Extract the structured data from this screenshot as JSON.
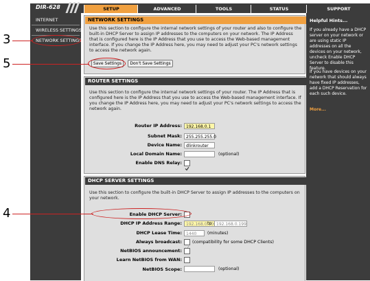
{
  "model": "DIR-628",
  "tabs": [
    "SETUP",
    "ADVANCED",
    "TOOLS",
    "STATUS",
    "SUPPORT"
  ],
  "nav": [
    "INTERNET",
    "WIRELESS SETTINGS",
    "NETWORK SETTINGS"
  ],
  "annotations": [
    "3",
    "5",
    "4"
  ],
  "network_settings": {
    "title": "NETWORK SETTINGS",
    "text": "Use this section to configure the internal network settings of your router and also to configure the built-in DHCP Server to assign IP addresses to the computers on your network. The IP Address that is configured here is the IP Address that you use to access the Web-based management interface. If you change the IP Address here, you may need to adjust your PC's network settings to access the network again.",
    "save": "Save Settings",
    "dont_save": "Don't Save Settings"
  },
  "router_settings": {
    "title": "ROUTER SETTINGS",
    "text": "Use this section to configure the internal network settings of your router. The IP Address that is configured here is the IP Address that you use to access the Web-based management interface. If you change the IP Address here, you may need to adjust your PC's network settings to access the network again.",
    "ip_label": "Router IP Address:",
    "ip_value": "192.168.0.1",
    "mask_label": "Subnet Mask:",
    "mask_value": "255.255.255.0",
    "device_label": "Device Name:",
    "device_value": "dlinkrouter",
    "domain_label": "Local Domain Name:",
    "domain_value": "",
    "optional": "(optional)",
    "dns_label": "Enable DNS Relay:"
  },
  "dhcp": {
    "title": "DHCP SERVER SETTINGS",
    "text": "Use this section to configure the built-in DHCP Server to assign IP addresses to the computers on your network.",
    "enable_label": "Enable DHCP Server:",
    "range_label": "DHCP IP Address Range:",
    "range_from": "192.168.0.100",
    "to": "to",
    "range_to": "192.168.0.199",
    "lease_label": "DHCP Lease Time:",
    "lease_value": "1440",
    "minutes": "(minutes)",
    "broadcast_label": "Always broadcast:",
    "broadcast_note": "(compatibility for some DHCP Clients)",
    "netbios_label": "NetBIOS announcement:",
    "learn_label": "Learn NetBIOS from WAN:",
    "scope_label": "NetBIOS Scope:",
    "scope_note": "(optional)"
  },
  "hints": {
    "title": "Helpful Hints...",
    "p1": "If you already have a DHCP server on your network or are using static IP addresses on all the devices on your network, uncheck Enable DHCP Server to disable this feature.",
    "p2": "If you have devices on your network that should always have fixed IP addresses, add a DHCP Reservation for each such device.",
    "more": "More..."
  },
  "colors": {
    "accent": "#f0a040",
    "annotation": "#cc2222",
    "dark": "#3c3c3c"
  }
}
